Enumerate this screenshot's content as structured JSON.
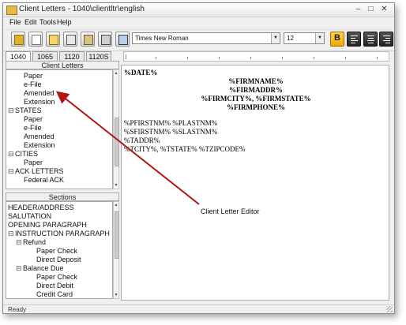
{
  "window": {
    "title": "Client Letters - 1040\\clientltr\\english",
    "controls": {
      "minimize": "–",
      "maximize": "□",
      "close": "✕"
    }
  },
  "menu": {
    "items": [
      "File",
      "Edit",
      "Tools",
      "Help"
    ]
  },
  "toolbar": {
    "buttons": [
      "open-folder-icon",
      "new-document-icon",
      "find-icon",
      "copy-icon",
      "paste-icon",
      "print-icon",
      "export-icon"
    ],
    "font": {
      "value": "Times New Roman",
      "dropdown_glyph": "▼"
    },
    "size": {
      "value": "12",
      "dropdown_glyph": "▼"
    },
    "format_buttons": {
      "bold": "B",
      "align": [
        "align-left-icon",
        "align-center-icon",
        "align-right-icon"
      ]
    },
    "colors": {
      "bold_active": "#f0a800",
      "arrow": "#b01414"
    }
  },
  "tabs": [
    "1040",
    "1065",
    "1120",
    "1120S"
  ],
  "client_letters": {
    "header": "Client Letters",
    "items": [
      {
        "label": "Paper",
        "level": 1
      },
      {
        "label": "e-File",
        "level": 1
      },
      {
        "label": "Amended",
        "level": 1
      },
      {
        "label": "Extension",
        "level": 1
      },
      {
        "label": "STATES",
        "level": 0,
        "expander": "⊟"
      },
      {
        "label": "Paper",
        "level": 1
      },
      {
        "label": "e-File",
        "level": 1
      },
      {
        "label": "Amended",
        "level": 1
      },
      {
        "label": "Extension",
        "level": 1
      },
      {
        "label": "CITIES",
        "level": 0,
        "expander": "⊟"
      },
      {
        "label": "Paper",
        "level": 1
      },
      {
        "label": "ACK LETTERS",
        "level": 0,
        "expander": "⊟"
      },
      {
        "label": "Federal ACK",
        "level": 1
      }
    ]
  },
  "sections": {
    "header": "Sections",
    "items": [
      {
        "label": "HEADER/ADDRESS",
        "level": 0
      },
      {
        "label": "SALUTATION",
        "level": 0
      },
      {
        "label": "OPENING PARAGRAPH",
        "level": 0
      },
      {
        "label": "INSTRUCTION PARAGRAPH",
        "level": 0,
        "expander": "⊟"
      },
      {
        "label": "Refund",
        "level": 1,
        "expander": "⊟"
      },
      {
        "label": "Paper Check",
        "level": 2
      },
      {
        "label": "Direct Deposit",
        "level": 2
      },
      {
        "label": "Balance Due",
        "level": 1,
        "expander": "⊟"
      },
      {
        "label": "Paper Check",
        "level": 2
      },
      {
        "label": "Direct Debit",
        "level": 2
      },
      {
        "label": "Credit Card",
        "level": 2
      }
    ]
  },
  "editor": {
    "lines": [
      {
        "text": "%DATE%",
        "align": "left",
        "bold": true
      },
      {
        "text": "%FIRMNAME%",
        "align": "center"
      },
      {
        "text": "%FIRMADDR%",
        "align": "center"
      },
      {
        "text": "%FIRMCITY%, %FIRMSTATE%",
        "align": "center"
      },
      {
        "text": "%FIRMPHONE%",
        "align": "center"
      },
      {
        "text": "",
        "align": "left"
      },
      {
        "text": "%PFIRSTNM% %PLASTNM%",
        "align": "left"
      },
      {
        "text": "%SFIRSTNM% %SLASTNM%",
        "align": "left"
      },
      {
        "text": "%TADDR%",
        "align": "left"
      },
      {
        "text": "%TCITY%, %TSTATE% %TZIPCODE%",
        "align": "left"
      }
    ]
  },
  "callout": {
    "label": "Client Letter Editor"
  },
  "status": {
    "text": "Ready"
  }
}
